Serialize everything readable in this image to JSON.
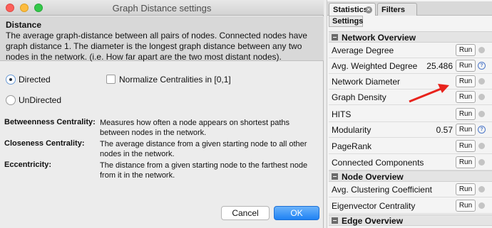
{
  "dialog": {
    "title": "Graph Distance settings",
    "description_heading": "Distance",
    "description_lines": [
      "The average graph-distance between all pairs of nodes. Connected nodes have",
      "graph distance 1. The diameter is the longest graph distance between any two",
      "nodes in the network. (i.e.  How far apart are the two most distant nodes)."
    ],
    "options": {
      "directed_label": "Directed",
      "undirected_label": "UnDirected",
      "selected": "Directed",
      "normalize_label": "Normalize Centralities in [0,1]",
      "normalize_checked": false
    },
    "definitions": [
      {
        "term": "Betweenness Centrality:",
        "lines": [
          "Measures how often a node appears on shortest paths",
          "between nodes in the network."
        ]
      },
      {
        "term": "Closeness Centrality:",
        "lines": [
          "The average distance from a given starting node to all other",
          "nodes in the network."
        ]
      },
      {
        "term": "Eccentricity:",
        "lines": [
          "The distance from a given starting node to the farthest node",
          "from it in the network."
        ]
      }
    ],
    "cancel_label": "Cancel",
    "ok_label": "OK"
  },
  "panel": {
    "tabs": [
      "Statistics",
      "Filters"
    ],
    "tab_close_glyph": "×",
    "subtab": "Settings",
    "run_label": "Run",
    "info_glyph": "?",
    "sections": [
      {
        "title": "Network Overview"
      },
      {
        "title": "Node Overview"
      },
      {
        "title": "Edge Overview"
      }
    ],
    "rows": [
      {
        "label": "Average Degree",
        "value": ""
      },
      {
        "label": "Avg. Weighted Degree",
        "value": "25.486"
      },
      {
        "label": "Network Diameter",
        "value": ""
      },
      {
        "label": "Graph Density",
        "value": ""
      },
      {
        "label": "HITS",
        "value": ""
      },
      {
        "label": "Modularity",
        "value": "0.57"
      },
      {
        "label": "PageRank",
        "value": ""
      },
      {
        "label": "Connected Components",
        "value": ""
      },
      {
        "label": "Avg. Clustering Coefficient",
        "value": ""
      },
      {
        "label": "Eigenvector Centrality",
        "value": ""
      }
    ]
  },
  "colors": {
    "ok_button": "#1f82f4",
    "annotation_arrow": "#e8231c",
    "info_icon": "#4d78c9"
  }
}
